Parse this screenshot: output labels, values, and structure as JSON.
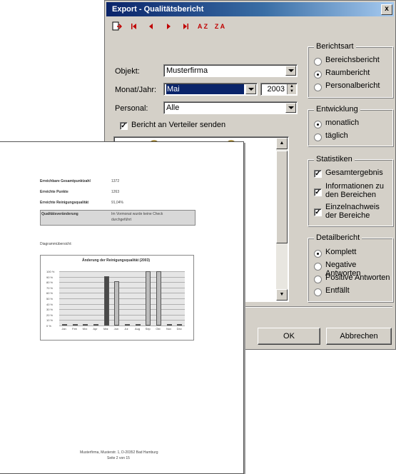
{
  "dialog": {
    "title": "Export - Qualitätsbericht",
    "close_label": "x",
    "toolbar": {
      "export_icon": "export-icon",
      "sort_asc_label": "A Z",
      "sort_desc_label": "Z A"
    },
    "objekt": {
      "label": "Objekt:",
      "value": "Musterfirma"
    },
    "monat": {
      "label": "Monat/Jahr:",
      "value": "Mai",
      "year": "2003"
    },
    "personal": {
      "label": "Personal:",
      "value": "Alle"
    },
    "verteiler": {
      "label": "Bericht an Verteiler senden",
      "checked": true
    },
    "berichtsart": {
      "title": "Berichtsart",
      "options": [
        "Bereichsbericht",
        "Raumbericht",
        "Personalbericht"
      ],
      "selected": "Raumbericht"
    },
    "entwicklung": {
      "title": "Entwicklung",
      "options": [
        "monatlich",
        "täglich"
      ],
      "selected": "monatlich"
    },
    "statistiken": {
      "title": "Statistiken",
      "gesamt": "Gesamtergebnis",
      "info_line1": "Informationen zu",
      "info_line2": "den Bereichen",
      "einzel_line1": "Einzelnachweis",
      "einzel_line2": "der Bereiche"
    },
    "detailbericht": {
      "title": "Detailbericht",
      "options": [
        "Komplett",
        "Negative Antworten",
        "Positive Antworten",
        "Entfällt"
      ],
      "selected": "Komplett"
    },
    "ok_label": "OK",
    "cancel_label": "Abbrechen"
  },
  "preview": {
    "rows": [
      {
        "label": "Erreichbare Gesamtpunktzahl",
        "value": "1372"
      },
      {
        "label": "Erreichte Punkte",
        "value": "1263"
      },
      {
        "label": "Erreichte Reinigungsqualität",
        "value": "91,04%"
      }
    ],
    "note_label": "Qualitätsveränderung",
    "note_line1": "Im Vormonat wurde keine Check",
    "note_line2": "durchgeführt",
    "diagram_heading": "Diagrammübersicht:",
    "footer_line1": "Musterfirma, Musterstr. 1, D-20352 Bad Hamburg",
    "footer_line2": "Seite 2 von 15",
    "chart_data": {
      "type": "bar",
      "title": "Änderung der Reinigungsqualität (2003)",
      "categories": [
        "Jan",
        "Feb",
        "Mrz",
        "Apr",
        "Mai",
        "Jun",
        "Jul",
        "Aug",
        "Sep",
        "Okt",
        "Nov",
        "Dez"
      ],
      "values": [
        0,
        0,
        0,
        0,
        91,
        82,
        0,
        0,
        100,
        100,
        0,
        0
      ],
      "ylim": [
        0,
        100
      ],
      "yticks": [
        "100 %",
        "90 %",
        "80 %",
        "70 %",
        "60 %",
        "50 %",
        "40 %",
        "30 %",
        "20 %",
        "10 %",
        "0 %"
      ],
      "colors": {
        "bar_dark": "#4a4a4a",
        "bar_light": "#bdbdbd",
        "plot_bg": "#e6e6e6"
      }
    }
  }
}
